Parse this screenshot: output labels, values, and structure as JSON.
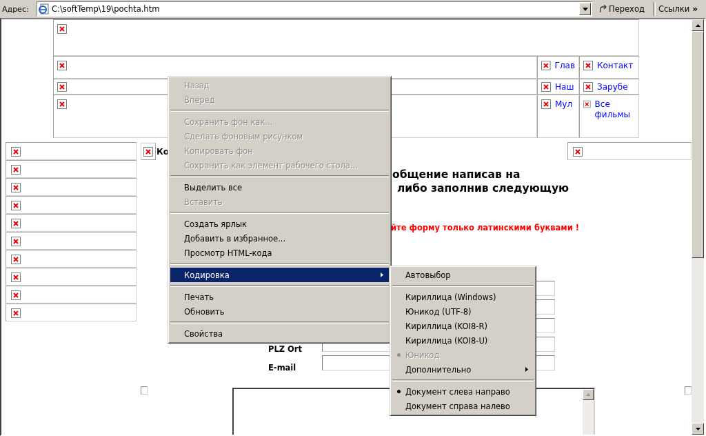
{
  "address_bar": {
    "label": "Адрес:",
    "url": "C:\\softTemp\\19\\pochta.htm",
    "go_button": "Переход",
    "links_label": "Ссылки",
    "links_more": "»"
  },
  "nav_rows": [
    {
      "links": [
        "Глав",
        "Контакт"
      ]
    },
    {
      "links": [
        "Наш",
        "Зарубе"
      ]
    },
    {
      "links": [
        "Мул",
        "Все фильмы"
      ]
    }
  ],
  "content": {
    "title_fragment": "Ко",
    "heading": [
      "общение написав на",
      "либо заполнив следующую"
    ],
    "notice": "йте форму только латинскими буквами !",
    "form_labels": [
      "PLZ Ort",
      "E-mail"
    ]
  },
  "context_menu": {
    "items": [
      {
        "kind": "item",
        "label": "Назад",
        "disabled": true,
        "selected": false,
        "has_submenu": false
      },
      {
        "kind": "item",
        "label": "Вперед",
        "disabled": true,
        "selected": false,
        "has_submenu": false
      },
      {
        "kind": "separator"
      },
      {
        "kind": "item",
        "label": "Сохранить фон как...",
        "disabled": true,
        "selected": false,
        "has_submenu": false
      },
      {
        "kind": "item",
        "label": "Сделать фоновым рисунком",
        "disabled": true,
        "selected": false,
        "has_submenu": false
      },
      {
        "kind": "item",
        "label": "Копировать фон",
        "disabled": true,
        "selected": false,
        "has_submenu": false
      },
      {
        "kind": "item",
        "label": "Сохранить как элемент рабочего стола...",
        "disabled": true,
        "selected": false,
        "has_submenu": false
      },
      {
        "kind": "separator"
      },
      {
        "kind": "item",
        "label": "Выделить все",
        "disabled": false,
        "selected": false,
        "has_submenu": false
      },
      {
        "kind": "item",
        "label": "Вставить",
        "disabled": true,
        "selected": false,
        "has_submenu": false
      },
      {
        "kind": "separator"
      },
      {
        "kind": "item",
        "label": "Создать ярлык",
        "disabled": false,
        "selected": false,
        "has_submenu": false
      },
      {
        "kind": "item",
        "label": "Добавить в избранное...",
        "disabled": false,
        "selected": false,
        "has_submenu": false
      },
      {
        "kind": "item",
        "label": "Просмотр HTML-кода",
        "disabled": false,
        "selected": false,
        "has_submenu": false
      },
      {
        "kind": "separator"
      },
      {
        "kind": "item",
        "label": "Кодировка",
        "disabled": false,
        "selected": true,
        "has_submenu": true
      },
      {
        "kind": "separator"
      },
      {
        "kind": "item",
        "label": "Печать",
        "disabled": false,
        "selected": false,
        "has_submenu": false
      },
      {
        "kind": "item",
        "label": "Обновить",
        "disabled": false,
        "selected": false,
        "has_submenu": false
      },
      {
        "kind": "separator"
      },
      {
        "kind": "item",
        "label": "Свойства",
        "disabled": false,
        "selected": false,
        "has_submenu": false
      }
    ]
  },
  "submenu": {
    "items": [
      {
        "kind": "item",
        "label": "Автовыбор",
        "disabled": false,
        "checked": false,
        "selected": false,
        "has_submenu": false
      },
      {
        "kind": "separator"
      },
      {
        "kind": "item",
        "label": "Кириллица (Windows)",
        "disabled": false,
        "checked": false,
        "selected": false,
        "has_submenu": false
      },
      {
        "kind": "item",
        "label": "Юникод (UTF-8)",
        "disabled": false,
        "checked": false,
        "selected": false,
        "has_submenu": false
      },
      {
        "kind": "item",
        "label": "Кириллица (KOI8-R)",
        "disabled": false,
        "checked": false,
        "selected": false,
        "has_submenu": false
      },
      {
        "kind": "item",
        "label": "Кириллица (KOI8-U)",
        "disabled": false,
        "checked": false,
        "selected": false,
        "has_submenu": false
      },
      {
        "kind": "item",
        "label": "Юникод",
        "disabled": true,
        "checked": true,
        "selected": false,
        "has_submenu": false
      },
      {
        "kind": "item",
        "label": "Дополнительно",
        "disabled": false,
        "checked": false,
        "selected": false,
        "has_submenu": true
      },
      {
        "kind": "separator"
      },
      {
        "kind": "item",
        "label": "Документ слева направо",
        "disabled": false,
        "checked": true,
        "selected": false,
        "has_submenu": false
      },
      {
        "kind": "item",
        "label": "Документ справа налево",
        "disabled": false,
        "checked": false,
        "selected": false,
        "has_submenu": false
      }
    ]
  }
}
